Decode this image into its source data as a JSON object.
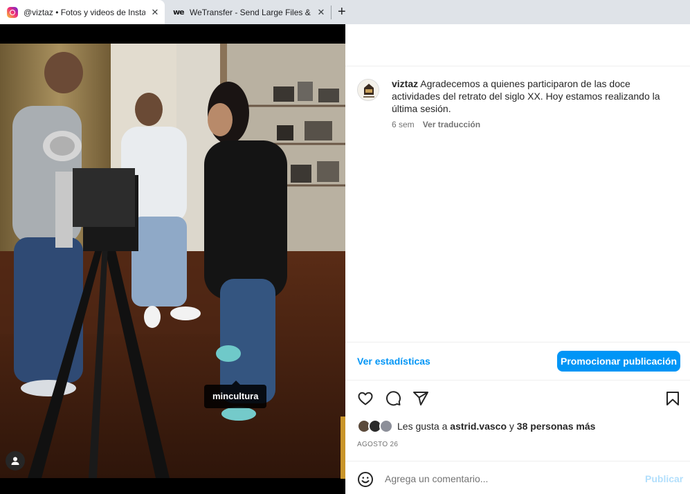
{
  "browser": {
    "tabs": [
      {
        "title": "@viztaz • Fotos y videos de Insta",
        "icon": "instagram-icon",
        "active": true
      },
      {
        "title": "WeTransfer - Send Large Files & S",
        "icon": "wetransfer-icon",
        "active": false
      }
    ],
    "close_glyph": "✕",
    "new_tab_glyph": "+",
    "wetransfer_favicon_text": "we"
  },
  "media": {
    "tag_label": "mincultura"
  },
  "post": {
    "username": "viztaz",
    "caption": "Agradecemos a quienes participaron de las doce actividades del retrato del siglo XX. Hoy estamos realizando la última sesión.",
    "time_ago": "6 sem",
    "translate_label": "Ver traducción",
    "stats_label": "Ver estadísticas",
    "promote_label": "Promocionar publicación",
    "likes": {
      "prefix": "Les gusta a ",
      "user": "astrid.vasco",
      "middle": " y ",
      "others": "38 personas más"
    },
    "date": "AGOSTO 26",
    "comment": {
      "placeholder": "Agrega un comentario...",
      "publish_label": "Publicar"
    }
  },
  "colors": {
    "accent": "#0095f6",
    "publish_disabled": "#b2dffc",
    "secondary_text": "#737373"
  }
}
